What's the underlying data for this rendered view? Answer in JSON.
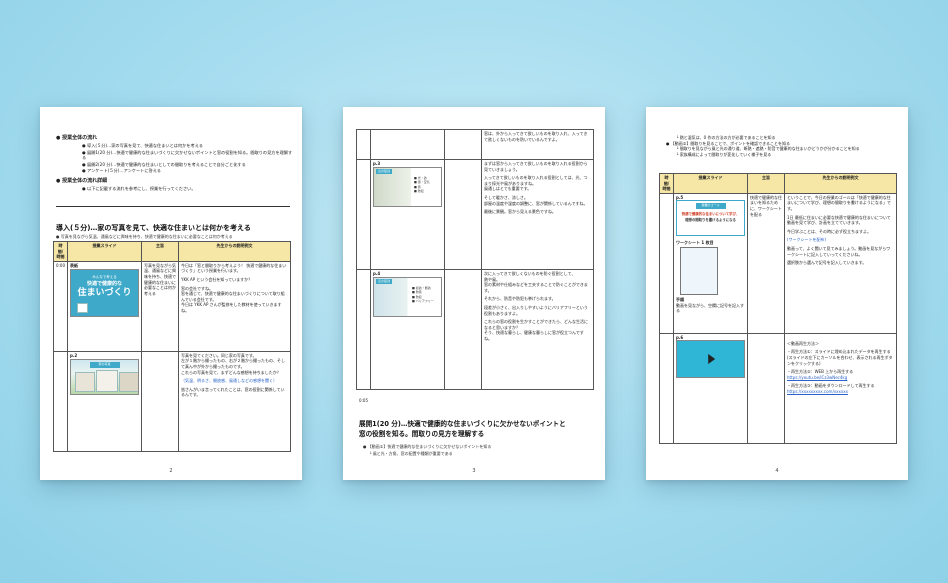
{
  "page2": {
    "number": "2",
    "lesson_flow_heading": "授業全体の流れ",
    "lesson_flow_items": [
      "導入(５分)…家の写真を見て、快適な住まいとは何かを考える",
      "展開1(20 分)…快適で健康的な住まいづくりに欠かせないポイントと窓の役割を知る。間取りの見方を理解する",
      "展開2(20 分)…快適で健康的な住まいとしての間取りを考えることで自分ごと化する",
      "アンケート(５分)…アンケートに答える"
    ],
    "detail_heading": "授業全体の流れ詳細",
    "detail_items": [
      "以下に記載する流れを参考にし、授業を行ってください。"
    ],
    "section_title": "導入(５分)…家の写真を見て、快適な住まいとは何かを考える",
    "section_note": "写真を見ながら気温、通風などに興味を持ち、快適で健康的な住まいに必要なことは何か考える",
    "table_headers": [
      "時間/時間",
      "授業スライド",
      "主旨",
      "先生からの説明例文"
    ],
    "rows": [
      {
        "time": "0:00",
        "slide_label": "表紙",
        "slide_title_small": "みんなで考える",
        "slide_title_line1": "快適で健康的な",
        "slide_title_line2": "住まいづくり",
        "summary": "写真を見ながら気温、通風などに興味を持ち、快適で健康的な住まいに必要なことは何か考える",
        "script_lines": [
          "今日は「窓と間取りから考えよう！ 快適で健康的な住まいづくり」という授業を行います。",
          "YKK AP という会社を知っていますか？",
          "窓の会社ですね。",
          "窓を通じて、快適で健康的な住まいづくりについて取り組んでいる会社です。",
          "今日は YKK AP さんが監修をした教材を使っていきますね。"
        ]
      },
      {
        "time": "",
        "slide_label": "p.2",
        "slide_title_small": "家の写真",
        "summary": "",
        "script_lines": [
          "写真を見てください。同じ家の写真です。",
          "左が１階から撮ったもの、右が２階から撮ったもの、そして真ん中が外から撮ったものです。",
          "これらの写真を見て、まずどんな感想を持ちましたか？"
        ],
        "script_blue": "（気温、明るさ、開放感、風通しなどの感想を聞く）",
        "script_end": "皆さんがいま言ってくれたことは、窓の役割に関係しているんです。"
      }
    ]
  },
  "page3": {
    "number": "3",
    "top_text": [
      "窓は、外から入ってきて欲しいものを取り入れ、入ってきて欲しくないものを防いでいるんですよ。"
    ],
    "rows": [
      {
        "slide_label": "p.3",
        "slide_title_small": "窓の役割",
        "slide_items": [
          "光・熱",
          "風・空気",
          "音",
          "防犯"
        ],
        "script_lines": [
          "まずは窓から入ってきて欲しいものを取り入れる役割から見ていきましょう。",
          "入ってきて欲しいものを取り入れる役割としては、光、つまり採光や風がありますね。",
          "風通しはとても重要です。",
          "そして暖かさ、涼しさ。",
          "部屋の温度や湿度の調整に、窓が関係しているんですね。",
          "最後に景観。窓から見える景色ですね。"
        ]
      },
      {
        "slide_label": "p.4",
        "slide_title_small": "窓の役割",
        "slide_items": [
          "遮熱・断熱",
          "防音",
          "防犯",
          "バリアフリー"
        ],
        "script_lines": [
          "次に入ってきて欲しくないものを防ぐ役割として、",
          "熱や風。",
          "窓の素材や仕組みなどを工夫することで防ぐことができます。",
          "それから、防音や防犯も挙げられます。",
          "段差が小さく、出入りしやすいようにバリアフリーという役割もありますよ。",
          "これらの窓の役割を生かすことができたら、どんな生活になると思いますか？",
          "そう、快適な暮らし、健康な暮らしに窓が役立つんですね。"
        ]
      }
    ],
    "time_after": "0:05",
    "section_title_line1": "展開1(20 分)…快適で健康的な住まいづくりに欠かせないポイントと",
    "section_title_line2": "窓の役割を知る。間取りの見方を理解する",
    "section_note": "【動画①】快適で健康的な住まいづくりに欠かせないポイントを知る",
    "section_subnote": "風と光・方角、窓の配置や種類が重要である"
  },
  "page4": {
    "number": "4",
    "top_lines": [
      "熱と湿気は、0 作の方法の方が必要であることを知る",
      "【動画②】間取りを見ることで、ポイントを確認できることを知る",
      "間取りを見ながら風と光の通り道、断熱・遮熱・防音で健康的な住まいかどうかが分かることを知る",
      "家族構成によって間取りが変化していく様子を見る"
    ],
    "table_headers": [
      "時間/時間",
      "授業スライド",
      "主旨",
      "先生からの説明例文"
    ],
    "rows": [
      {
        "slide_label": "p.5",
        "slide_title_small": "授業のゴール",
        "slide_line1": "快適で健康的な住まいについて学び、",
        "slide_line2": "理想の間取りを書けるようになる",
        "worksheet_label": "ワークシート 1 枚目",
        "handout_label": "手順",
        "handout_text": "動画を見ながら、空欄に記号を記入する",
        "summary": "快適で健康的な住まいを知るために、ワークシートを配る",
        "script_lines": [
          "ということで、今日の授業のゴールは「快適で健康的な住まいについて学び、理想の間取りを書けるようになる」です。",
          "1日 最低に住まいに必要な快適で健康的な住まいについて動画を見て学び、計画を立てていきます。",
          "今日学ぶことは、その時に必ず役立ちますよ。"
        ],
        "script_blue": "(ワークシートを配布)",
        "script_after": [
          "動画って、よく聞いて見てみましょう。動画を見ながらワークシートに記入していってくださいね。",
          "選択肢から選んで記号を記入していきます。"
        ]
      },
      {
        "slide_label": "p.6",
        "summary": "",
        "script_lines": [
          "＜動画再生方法＞",
          "・再生方法①：スライドに埋め込まれたデータを再生する",
          "(スライドの左下にカーソルを合わせ、表示される再生ボタンをクリックする)",
          "・再生方法②：WEB 上から再生する",
          "・再生方法③：動画をダウンロードして再生する"
        ],
        "link1": "https://youtu.be/iCz3wNec4kg",
        "link2": "https://xxxxxxxxx.com/xxxxxx"
      }
    ]
  }
}
